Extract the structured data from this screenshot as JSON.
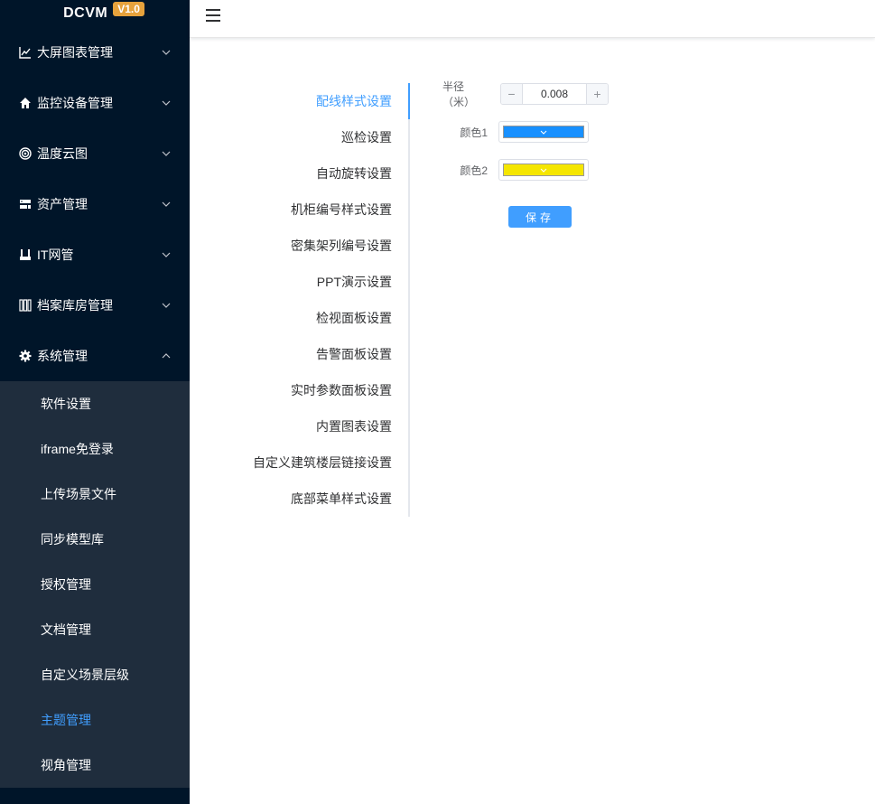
{
  "brand": {
    "name": "DCVM",
    "version": "V1.0"
  },
  "sidebar": {
    "menus": [
      {
        "label": "大屏图表管理",
        "icon": "line-chart-icon",
        "expanded": false
      },
      {
        "label": "监控设备管理",
        "icon": "home-icon",
        "expanded": false
      },
      {
        "label": "温度云图",
        "icon": "target-icon",
        "expanded": false
      },
      {
        "label": "资产管理",
        "icon": "server-icon",
        "expanded": false
      },
      {
        "label": "IT网管",
        "icon": "network-icon",
        "expanded": false
      },
      {
        "label": "档案库房管理",
        "icon": "archive-icon",
        "expanded": false
      },
      {
        "label": "系统管理",
        "icon": "gear-icon",
        "expanded": true
      }
    ],
    "submenu": [
      {
        "label": "软件设置"
      },
      {
        "label": "iframe免登录"
      },
      {
        "label": "上传场景文件"
      },
      {
        "label": "同步模型库"
      },
      {
        "label": "授权管理"
      },
      {
        "label": "文档管理"
      },
      {
        "label": "自定义场景层级"
      },
      {
        "label": "主题管理",
        "active": true
      },
      {
        "label": "视角管理"
      }
    ]
  },
  "tabs": [
    {
      "label": "配线样式设置",
      "active": true
    },
    {
      "label": "巡检设置"
    },
    {
      "label": "自动旋转设置"
    },
    {
      "label": "机柜编号样式设置"
    },
    {
      "label": "密集架列编号设置"
    },
    {
      "label": "PPT演示设置"
    },
    {
      "label": "检视面板设置"
    },
    {
      "label": "告警面板设置"
    },
    {
      "label": "实时参数面板设置"
    },
    {
      "label": "内置图表设置"
    },
    {
      "label": "自定义建筑楼层链接设置"
    },
    {
      "label": "底部菜单样式设置"
    }
  ],
  "form": {
    "radius_label": "半径（米）",
    "radius_value": "0.008",
    "color1_label": "颜色1",
    "color1_value": "#1890ff",
    "color2_label": "颜色2",
    "color2_value": "#f5e600",
    "save_label": "保存"
  },
  "colors": {
    "sidebar_bg": "#001529",
    "submenu_bg": "#1f2d3d",
    "accent": "#409eff",
    "badge": "#e6a23c"
  }
}
